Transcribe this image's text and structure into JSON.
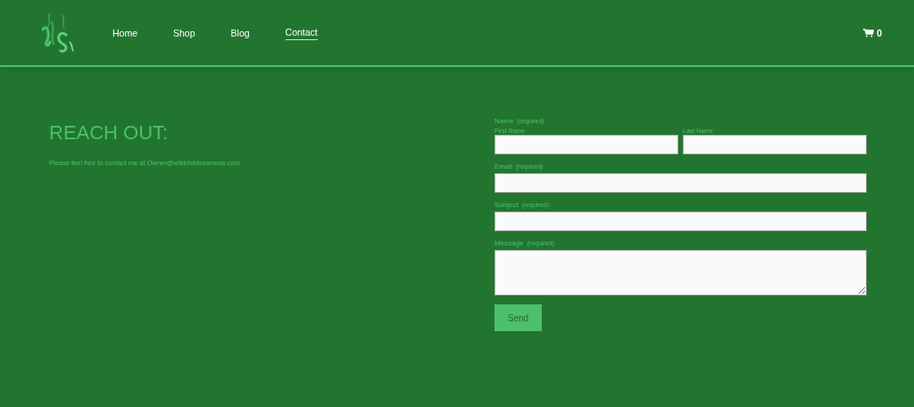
{
  "header": {
    "nav": [
      {
        "label": "Home",
        "selected": false
      },
      {
        "label": "Shop",
        "selected": false
      },
      {
        "label": "Blog",
        "selected": false
      },
      {
        "label": "Contact",
        "selected": true
      }
    ],
    "cart_count": "0"
  },
  "intro": {
    "title": "REACH OUT:",
    "text": "Please feel free to contact me at Owner@wildchildseamoss.com"
  },
  "form": {
    "fields": [
      {
        "kind": "split",
        "label": "Name",
        "note": "(required)",
        "parts": [
          "First Name",
          "Last Name"
        ]
      },
      {
        "kind": "text",
        "label": "Email",
        "note": "(required)"
      },
      {
        "kind": "text",
        "label": "Subject",
        "note": "(required)"
      },
      {
        "kind": "textarea",
        "label": "Message",
        "note": "(required)"
      }
    ],
    "submit": "Send"
  }
}
